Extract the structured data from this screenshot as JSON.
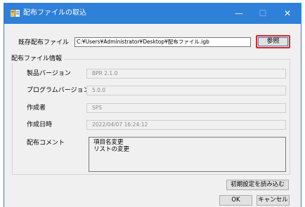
{
  "window": {
    "title": "配布ファイルの取込",
    "minimize_glyph": "—",
    "maximize_glyph": "☐",
    "close_glyph": "✕",
    "titlebar_color": "#2f80d8"
  },
  "existing_file": {
    "label": "既存配布ファイル",
    "path": "C:¥Users¥Administrator¥Desktop¥配布ファイル.igb",
    "browse_label": "参照"
  },
  "info": {
    "legend": "配布ファイル情報",
    "product_version_label": "製品バージョン",
    "product_version": "BPR 2.1.0",
    "program_version_label": "プログラムバージョン",
    "program_version": "5.0.0",
    "author_label": "作成者",
    "author": "SPS",
    "created_label": "作成日時",
    "created": "2022/04/07 16:24:12",
    "comment_label": "配布コメント",
    "comment_lines": [
      "項目名変更",
      "リストの変更"
    ]
  },
  "buttons": {
    "load_initial": "初期設定を読み込む",
    "ok": "OK",
    "cancel": "キャンセル"
  }
}
